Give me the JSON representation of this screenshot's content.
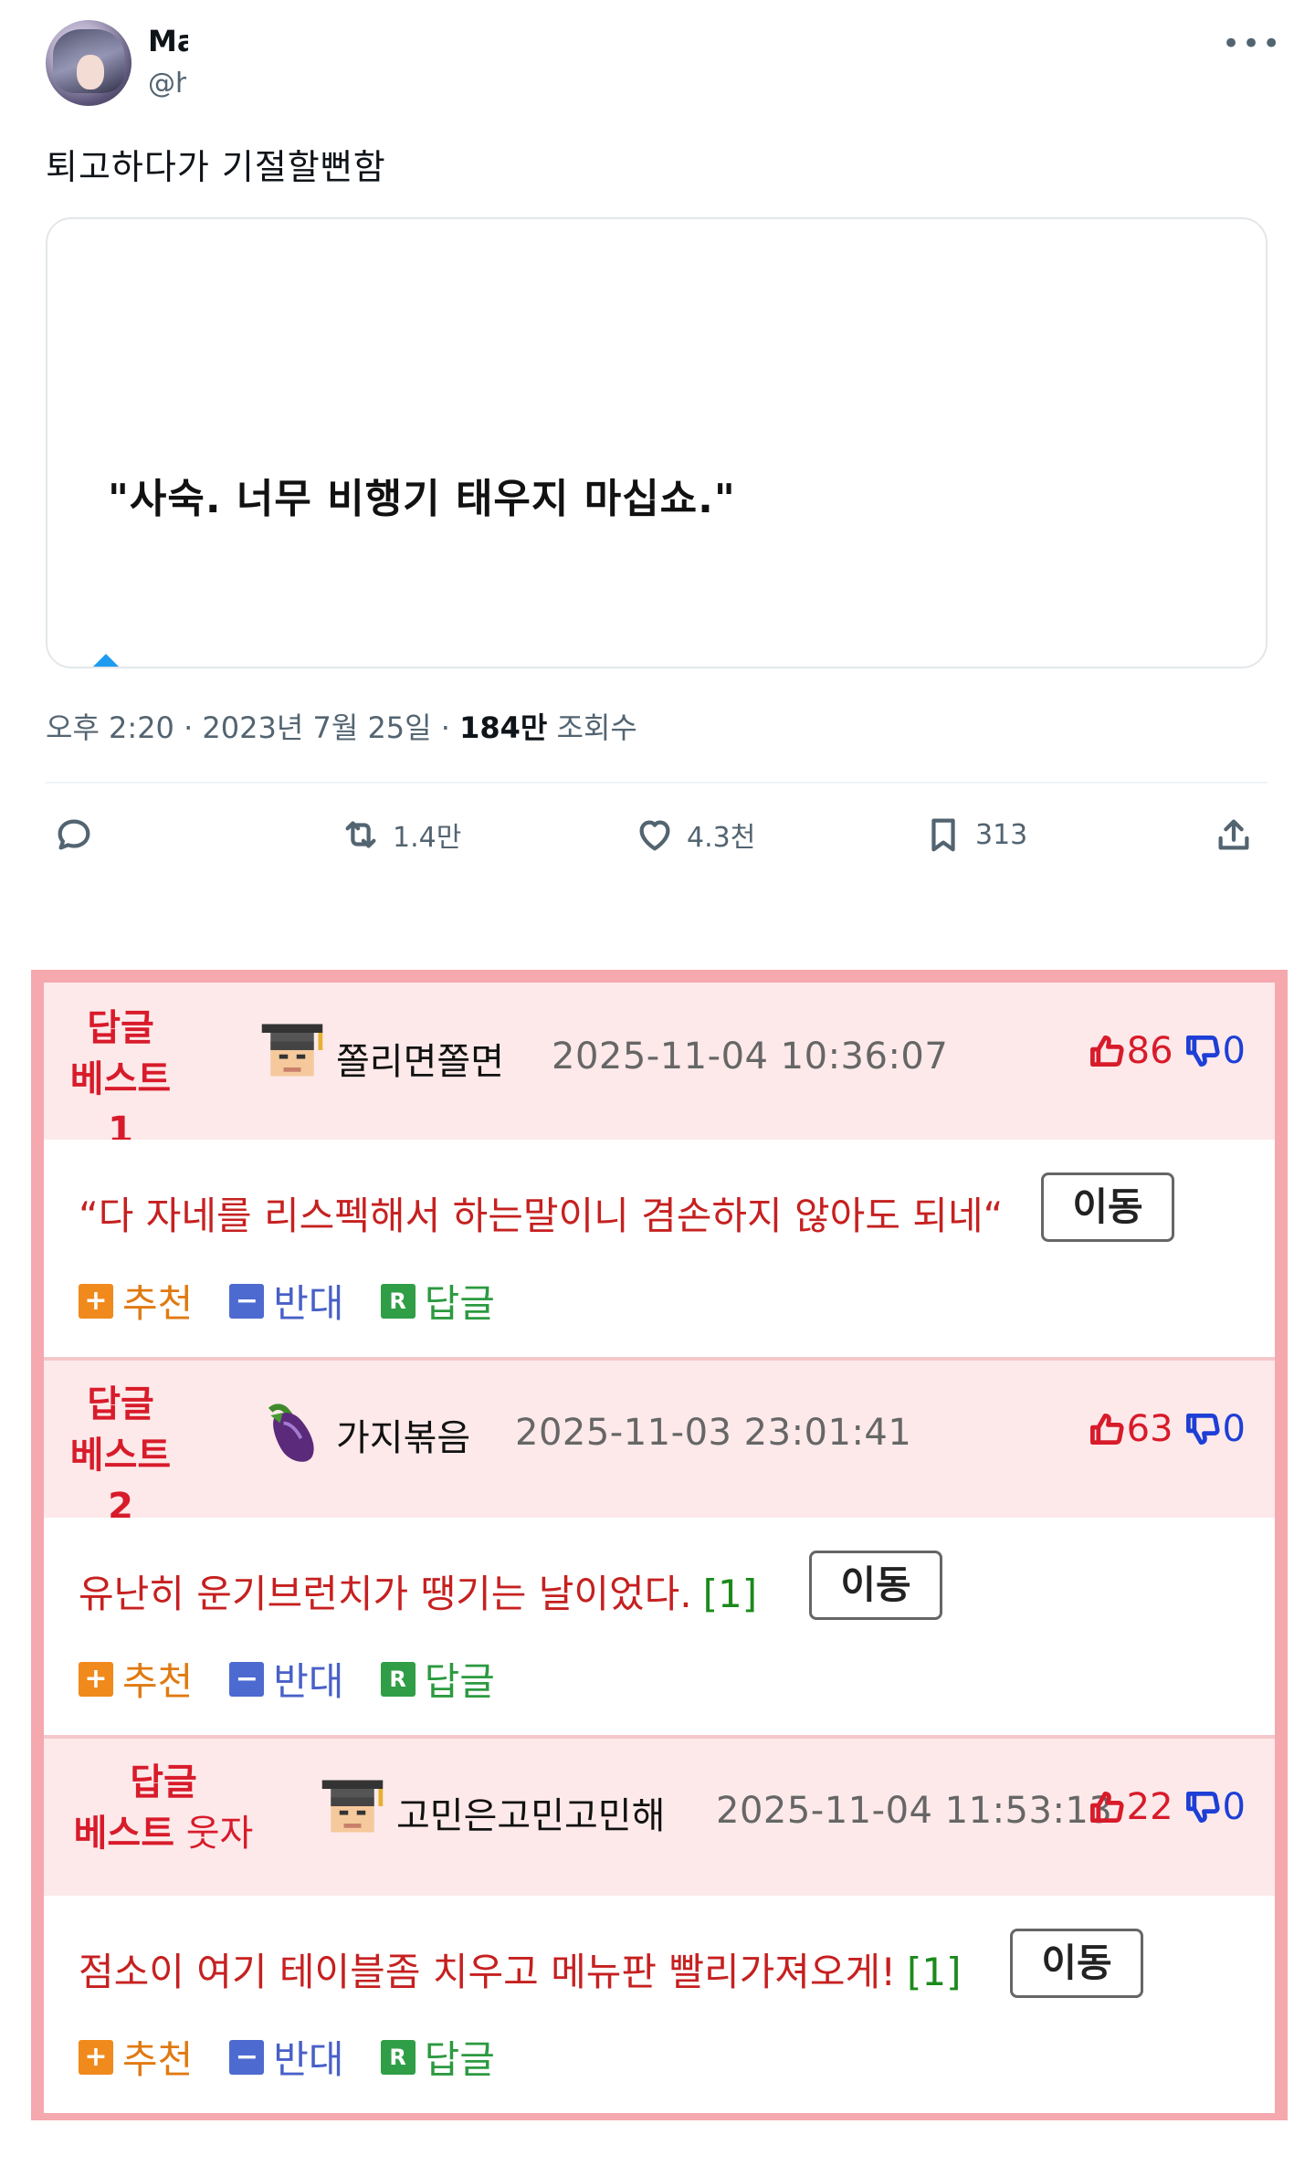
{
  "tweet": {
    "author_name": "Ma",
    "author_handle": "@h",
    "more_icon": "more-horizontal-icon",
    "text": "퇴고하다가 기절할뻔함",
    "media_caption": "\"사숙. 너무 비행기 태우지 마십쇼.\"",
    "meta_time": "오후 2:20 · 2023년 7월 25일 · ",
    "meta_views": "184만",
    "meta_views_label": " 조회수",
    "actions": {
      "reply_icon": "reply-icon",
      "retweet_icon": "retweet-icon",
      "retweet_count": "1.4만",
      "like_icon": "heart-icon",
      "like_count": "4.3천",
      "bookmark_icon": "bookmark-icon",
      "bookmark_count": "313",
      "share_icon": "share-icon"
    }
  },
  "comments": [
    {
      "badge_line1": "답글",
      "badge_line2": "베스트1",
      "badge_extra": "",
      "nick_icon": "graduate-icon",
      "nickname": "쫄리면쫄면",
      "date": "2025-11-04 10:36:07",
      "up_votes": "86",
      "down_votes": "0",
      "text": "“다 자네를 리스펙해서 하는말이니 겸손하지 않아도 되네“",
      "reply_count": "",
      "move_label": "이동",
      "recommend_label": "추천",
      "oppose_label": "반대",
      "reply_label": "답글"
    },
    {
      "badge_line1": "답글",
      "badge_line2": "베스트2",
      "badge_extra": "",
      "nick_icon": "eggplant-icon",
      "nickname": "가지볶음",
      "date": "2025-11-03 23:01:41",
      "up_votes": "63",
      "down_votes": "0",
      "text": "유난히 운기브런치가 땡기는 날이었다.",
      "reply_count": "[1]",
      "move_label": "이동",
      "recommend_label": "추천",
      "oppose_label": "반대",
      "reply_label": "답글"
    },
    {
      "badge_line1": "답글",
      "badge_line2": "베스트",
      "badge_extra": " 웃자",
      "nick_icon": "graduate-icon",
      "nickname": "고민은고민고민해",
      "date": "2025-11-04 11:53:13",
      "up_votes": "22",
      "down_votes": "0",
      "text": "점소이 여기 테이블좀 치우고 메뉴판 빨리가져오게!",
      "reply_count": "[1]",
      "move_label": "이동",
      "recommend_label": "추천",
      "oppose_label": "반대",
      "reply_label": "답글"
    }
  ],
  "colors": {
    "panel_border": "#f5a8ae",
    "header_bg": "#fde9ea",
    "comment_text": "#c62020",
    "badge": "#d81b2a",
    "up_vote": "#d81b2a",
    "down_vote": "#1e3fd6"
  }
}
